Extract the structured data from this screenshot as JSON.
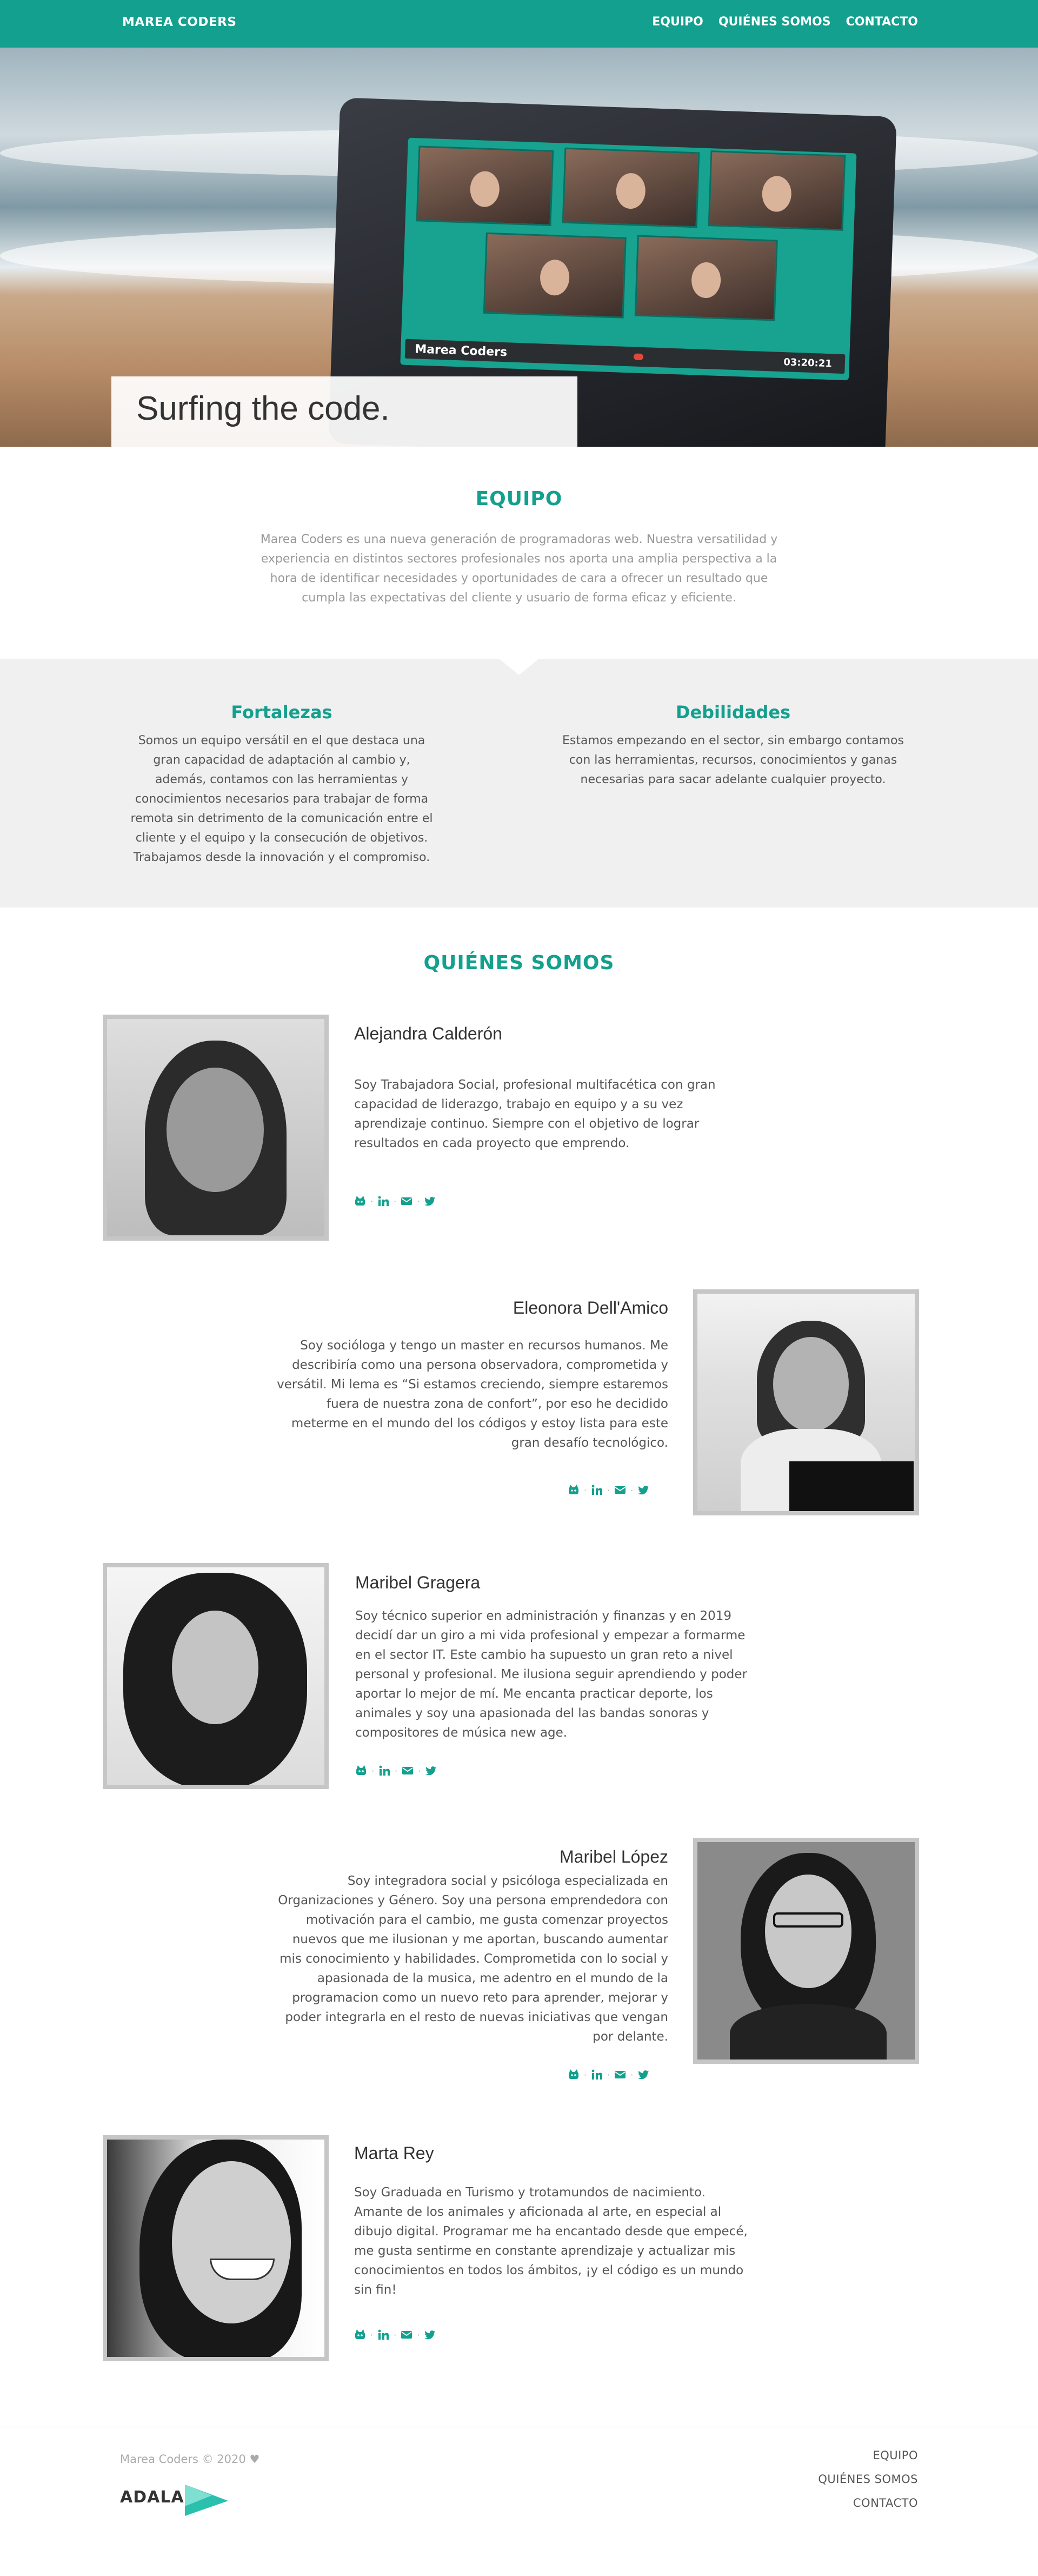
{
  "header": {
    "brand": "MAREA CODERS",
    "nav": [
      "EQUIPO",
      "QUIÉNES SOMOS",
      "CONTACTO"
    ]
  },
  "hero": {
    "tagline": "Surfing the code.",
    "screen_label": "Marea Coders",
    "screen_time": "03:20:21"
  },
  "equipo": {
    "title": "EQUIPO",
    "intro": "Marea Coders es una nueva generación de programadoras web. Nuestra versatilidad y experiencia en distintos sectores profesionales nos aporta una amplia perspectiva a la hora de identificar necesidades y oportunidades de cara a ofrecer un resultado que cumpla las expectativas del cliente y usuario de forma eficaz y eficiente."
  },
  "analysis": {
    "strengths_title": "Fortalezas",
    "strengths_text": "Somos un equipo versátil en el que destaca una gran capacidad de adaptación al cambio y, además, contamos con las herramientas y conocimientos necesarios para trabajar de forma remota sin detrimento de la comunicación entre el cliente y el equipo y la consecución de objetivos. Trabajamos desde la innovación y el compromiso.",
    "weaknesses_title": "Debilidades",
    "weaknesses_text": "Estamos empezando en el sector, sin embargo contamos con las herramientas, recursos, conocimientos y ganas necesarias para sacar adelante cualquier proyecto."
  },
  "quienes": {
    "title": "QUIÉNES SOMOS",
    "members": [
      {
        "name": "Alejandra Calderón",
        "bio": "Soy Trabajadora Social, profesional multifacética con gran capacidad de liderazgo, trabajo en equipo y a su vez aprendizaje continuo. Siempre con el objetivo de lograr resultados en cada proyecto que emprendo."
      },
      {
        "name": "Eleonora Dell'Amico",
        "bio": "Soy socióloga y tengo un master en recursos humanos. Me describiría como una persona observadora, comprometida y versátil. Mi lema es “Si estamos creciendo, siempre estaremos fuera de nuestra zona de confort”, por eso he decidido meterme en el mundo del los códigos y estoy lista para este gran desafío tecnológico."
      },
      {
        "name": "Maribel Gragera",
        "bio": "Soy técnico superior en administración y finanzas y en 2019 decidí dar un giro a mi vida profesional y empezar a formarme en el sector IT. Este cambio ha supuesto un gran reto a nivel personal y profesional. Me ilusiona seguir aprendiendo y poder aportar lo mejor de mí. Me encanta practicar deporte, los animales y soy una apasionada del las bandas sonoras y compositores de música new age."
      },
      {
        "name": "Maribel López",
        "bio": "Soy integradora social y psicóloga especializada en Organizaciones y Género. Soy una persona emprendedora con motivación para el cambio, me gusta comenzar proyectos nuevos que me ilusionan y me aportan, buscando aumentar mis conocimiento y habilidades. Comprometida con lo social y apasionada de la musica, me adentro en el mundo de la programacion como un nuevo reto para aprender, mejorar y poder integrarla en el resto de nuevas iniciativas que vengan por delante."
      },
      {
        "name": "Marta Rey",
        "bio": "Soy Graduada en Turismo y trotamundos de nacimiento. Amante de los animales y aficionada al arte, en especial al dibujo digital. Programar me ha encantado desde que empecé, me gusta sentirme en constante aprendizaje y actualizar mis conocimientos en todos los ámbitos, ¡y el código es un mundo sin fin!"
      }
    ],
    "social_icons": [
      "github-icon",
      "linkedin-icon",
      "envelope-icon",
      "twitter-icon"
    ]
  },
  "footer": {
    "copyright": "Marea Coders © 2020",
    "logo_text": "ADALAB",
    "nav": [
      "EQUIPO",
      "QUIÉNES SOMOS",
      "CONTACTO"
    ]
  },
  "colors": {
    "accent": "#13a08e",
    "band": "#f0f0f0",
    "text": "#555555",
    "muted": "#999999"
  }
}
